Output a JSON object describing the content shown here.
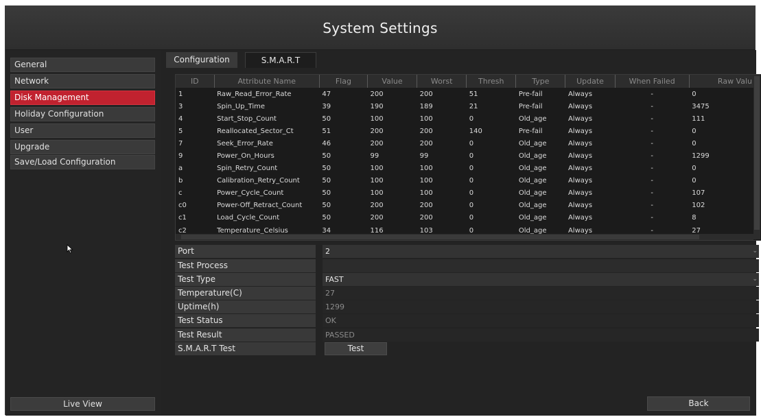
{
  "window": {
    "title": "System Settings"
  },
  "sidebar": {
    "items": [
      {
        "label": "General"
      },
      {
        "label": "Network"
      },
      {
        "label": "Disk Management"
      },
      {
        "label": "Holiday Configuration"
      },
      {
        "label": "User"
      },
      {
        "label": "Upgrade"
      },
      {
        "label": "Save/Load Configuration"
      }
    ],
    "active_index": 2,
    "live_view_label": "Live View"
  },
  "tabs": [
    {
      "label": "Configuration"
    },
    {
      "label": "S.M.A.R.T"
    }
  ],
  "active_tab": 1,
  "smart_table": {
    "headers": [
      "ID",
      "Attribute Name",
      "Flag",
      "Value",
      "Worst",
      "Thresh",
      "Type",
      "Update",
      "When Failed",
      "Raw Valu"
    ],
    "rows": [
      [
        "1",
        "Raw_Read_Error_Rate",
        "47",
        "200",
        "200",
        "51",
        "Pre-fail",
        "Always",
        "-",
        "0"
      ],
      [
        "3",
        "Spin_Up_Time",
        "39",
        "190",
        "189",
        "21",
        "Pre-fail",
        "Always",
        "-",
        "3475"
      ],
      [
        "4",
        "Start_Stop_Count",
        "50",
        "100",
        "100",
        "0",
        "Old_age",
        "Always",
        "-",
        "111"
      ],
      [
        "5",
        "Reallocated_Sector_Ct",
        "51",
        "200",
        "200",
        "140",
        "Pre-fail",
        "Always",
        "-",
        "0"
      ],
      [
        "7",
        "Seek_Error_Rate",
        "46",
        "200",
        "200",
        "0",
        "Old_age",
        "Always",
        "-",
        "0"
      ],
      [
        "9",
        "Power_On_Hours",
        "50",
        "99",
        "99",
        "0",
        "Old_age",
        "Always",
        "-",
        "1299"
      ],
      [
        "a",
        "Spin_Retry_Count",
        "50",
        "100",
        "100",
        "0",
        "Old_age",
        "Always",
        "-",
        "0"
      ],
      [
        "b",
        "Calibration_Retry_Count",
        "50",
        "100",
        "100",
        "0",
        "Old_age",
        "Always",
        "-",
        "0"
      ],
      [
        "c",
        "Power_Cycle_Count",
        "50",
        "100",
        "100",
        "0",
        "Old_age",
        "Always",
        "-",
        "107"
      ],
      [
        "c0",
        "Power-Off_Retract_Count",
        "50",
        "200",
        "200",
        "0",
        "Old_age",
        "Always",
        "-",
        "102"
      ],
      [
        "c1",
        "Load_Cycle_Count",
        "50",
        "200",
        "200",
        "0",
        "Old_age",
        "Always",
        "-",
        "8"
      ],
      [
        "c2",
        "Temperature_Celsius",
        "34",
        "116",
        "103",
        "0",
        "Old_age",
        "Always",
        "-",
        "27"
      ]
    ]
  },
  "form": {
    "port": {
      "label": "Port",
      "value": "2"
    },
    "test_process": {
      "label": "Test Process",
      "value": ""
    },
    "test_type": {
      "label": "Test Type",
      "value": "FAST"
    },
    "temperature": {
      "label": "Temperature(C)",
      "value": "27"
    },
    "uptime": {
      "label": "Uptime(h)",
      "value": "1299"
    },
    "test_status": {
      "label": "Test Status",
      "value": "OK"
    },
    "test_result": {
      "label": "Test Result",
      "value": "PASSED"
    },
    "smart_test": {
      "label": "S.M.A.R.T Test",
      "button_label": "Test"
    }
  },
  "back_label": "Back",
  "colors": {
    "accent": "#c1222f",
    "background": "#2b2b2b"
  }
}
